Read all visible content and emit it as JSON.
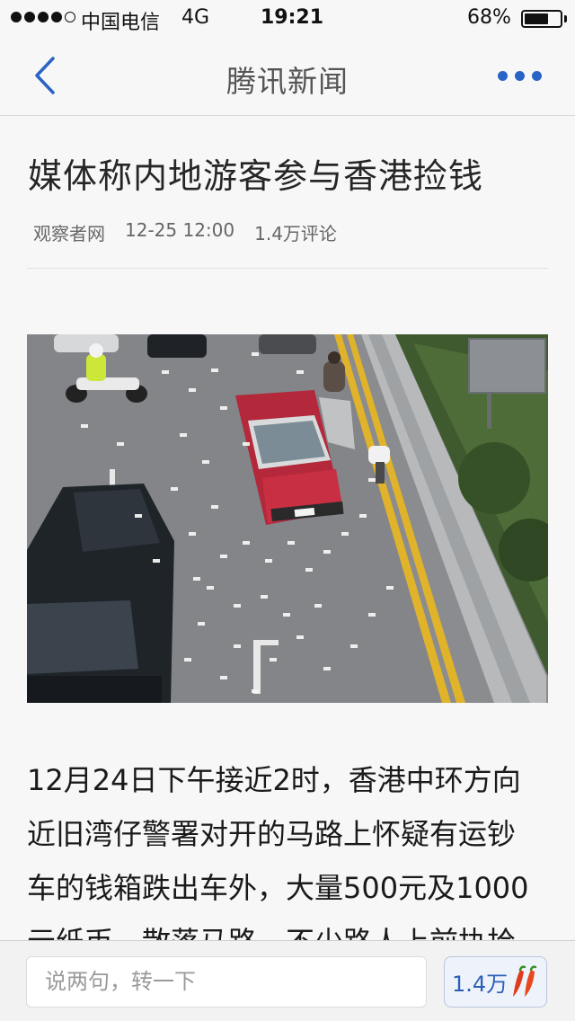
{
  "status_bar": {
    "carrier": "中国电信",
    "network": "4G",
    "time": "19:21",
    "battery_percent": "68%",
    "battery_level": 0.68,
    "signal_bars_filled": 4,
    "signal_bars_total": 5
  },
  "nav": {
    "title": "腾讯新闻",
    "back_icon": "chevron-left-icon",
    "more_icon": "more-dots-icon",
    "accent_color": "#2a63c6"
  },
  "article": {
    "title": "媒体称内地游客参与香港捡钱",
    "source": "观察者网",
    "datetime": "12-25 12:00",
    "comments": "1.4万评论",
    "body_lines": [
      "12月24日下午接近2时，香港中环方向",
      "近旧湾仔警署对开的马路上怀疑有运钞",
      "车的钱箱跌出车外，大量500元及1000",
      "元纸币，散落马路。不少路人上前执拾"
    ]
  },
  "comment_bar": {
    "placeholder": "说两句，转一下",
    "count": "1.4万",
    "count_icon": "chili-pepper-icon"
  }
}
